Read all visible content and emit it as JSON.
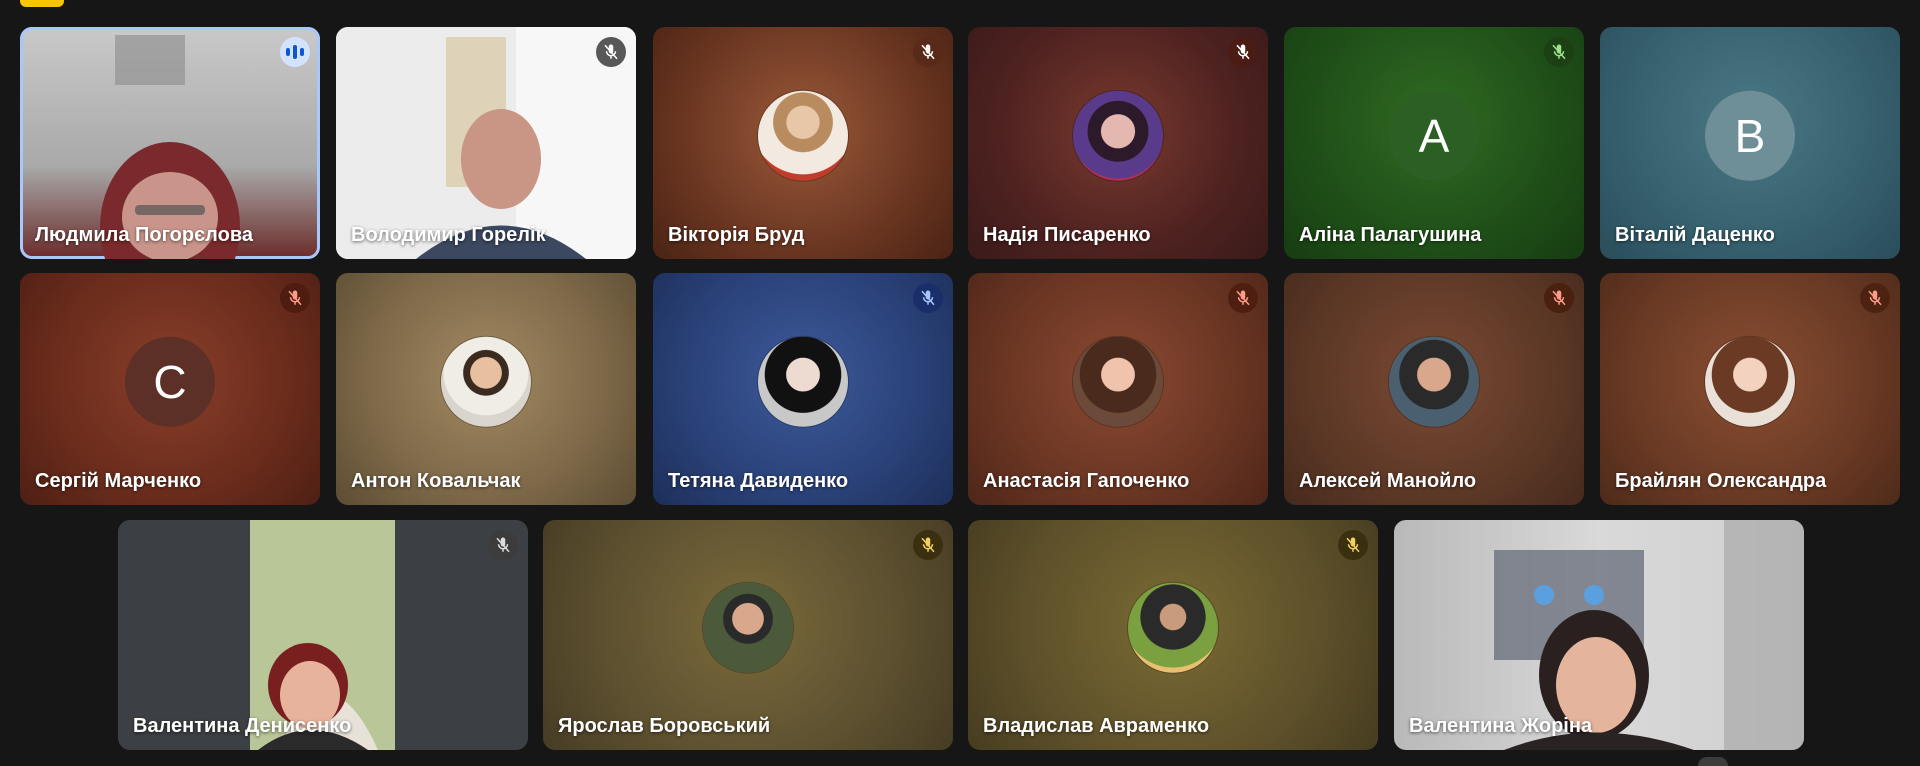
{
  "participants": [
    {
      "name": "Людмила Погорєлова",
      "mic": "speaking"
    },
    {
      "name": "Володимир Горелік",
      "mic": "muted"
    },
    {
      "name": "Вікторія Бруд",
      "mic": "muted"
    },
    {
      "name": "Надія Писаренко",
      "mic": "muted"
    },
    {
      "name": "Аліна Палагушина",
      "mic": "muted",
      "initial": "А"
    },
    {
      "name": "Віталій Даценко",
      "initial": "В"
    },
    {
      "name": "Сергій Марченко",
      "mic": "muted",
      "initial": "С"
    },
    {
      "name": "Антон Ковальчак"
    },
    {
      "name": "Тетяна Давиденко",
      "mic": "muted"
    },
    {
      "name": "Анастасія Гапоченко",
      "mic": "muted"
    },
    {
      "name": "Алексей Манойло",
      "mic": "muted"
    },
    {
      "name": "Брайлян Олександра",
      "mic": "muted"
    },
    {
      "name": "Валентина Денисенко",
      "mic": "muted"
    },
    {
      "name": "Ярослав Боровський",
      "mic": "muted"
    },
    {
      "name": "Владислав Авраменко",
      "mic": "muted"
    },
    {
      "name": "Валентина Жоріна"
    }
  ],
  "colors": {
    "speaking_ring": "#a8c7fa",
    "top_chip": "#f7c600",
    "background": "#161616"
  }
}
